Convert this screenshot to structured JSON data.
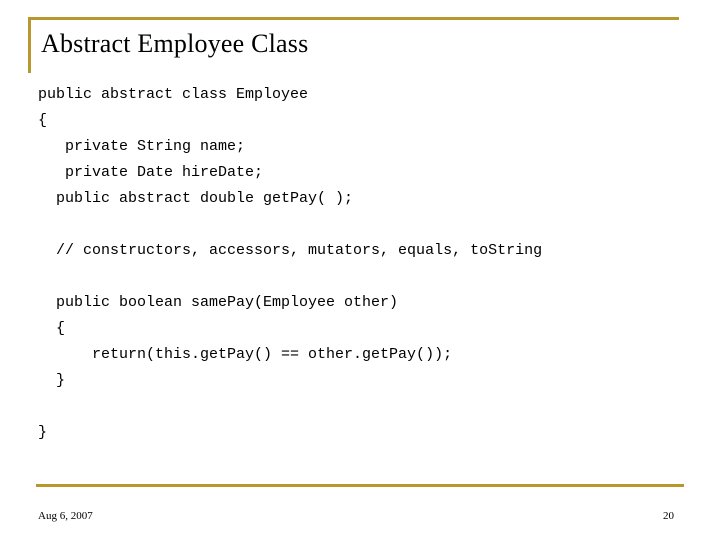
{
  "slide": {
    "title": "Abstract Employee Class",
    "accent_color": "#b8972e",
    "background_color": "#ffffff",
    "text_color": "#000000"
  },
  "code": {
    "language": "java",
    "lines": [
      "public abstract class Employee",
      "{",
      "   private String name;",
      "   private Date hireDate;",
      "  public abstract double getPay( );",
      "",
      "  // constructors, accessors, mutators, equals, toString",
      "",
      "  public boolean samePay(Employee other)",
      "  {",
      "      return(this.getPay() == other.getPay());",
      "  }",
      "",
      "}"
    ]
  },
  "footer": {
    "date": "Aug 6, 2007",
    "page_number": "20"
  }
}
